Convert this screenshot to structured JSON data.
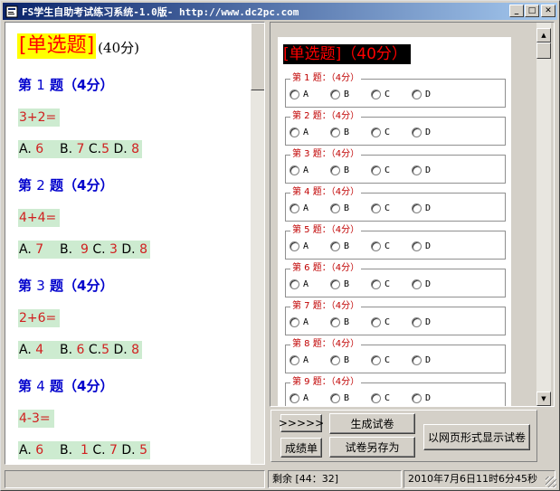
{
  "window": {
    "title": "FS学生自助考试练习系统-1.0版- http://www.dc2pc.com",
    "minimize": "_",
    "maximize": "□",
    "close": "✕"
  },
  "left": {
    "header_bracket": "[单选题]",
    "header_points": "(40分)",
    "questions": [
      {
        "title_a": "第",
        "num": "1",
        "title_b": "题（4分）",
        "expr": "3+2=",
        "opts": {
          "a_lab": "A.",
          "a_val": "6",
          "b_lab": "B.",
          "b_val": "7",
          "c_lab": "C.",
          "c_val": "5",
          "d_lab": "D.",
          "d_val": "8"
        }
      },
      {
        "title_a": "第",
        "num": "2",
        "title_b": "题（4分）",
        "expr": "4+4=",
        "opts": {
          "a_lab": "A.",
          "a_val": "7",
          "b_lab": "B.",
          "b_val": "9",
          "c_lab": "C.",
          "c_val": "3",
          "d_lab": "D.",
          "d_val": "8"
        }
      },
      {
        "title_a": "第",
        "num": "3",
        "title_b": "题（4分）",
        "expr": "2+6=",
        "opts": {
          "a_lab": "A.",
          "a_val": "4",
          "b_lab": "B.",
          "b_val": "6",
          "c_lab": "C.",
          "c_val": "5",
          "d_lab": "D.",
          "d_val": "8"
        }
      },
      {
        "title_a": "第",
        "num": "4",
        "title_b": "题（4分）",
        "expr": "4-3=",
        "opts": {
          "a_lab": "A.",
          "a_val": "6",
          "b_lab": "B.",
          "b_val": "1",
          "c_lab": "C.",
          "c_val": "7",
          "d_lab": "D.",
          "d_val": "5"
        }
      }
    ]
  },
  "right": {
    "header": "[单选题]（40分）",
    "questions": [
      {
        "title": "第 1 题：（4分）"
      },
      {
        "title": "第 2 题：（4分）"
      },
      {
        "title": "第 3 题：（4分）"
      },
      {
        "title": "第 4 题：（4分）"
      },
      {
        "title": "第 5 题：（4分）"
      },
      {
        "title": "第 6 题：（4分）"
      },
      {
        "title": "第 7 题：（4分）"
      },
      {
        "title": "第 8 题：（4分）"
      },
      {
        "title": "第 9 题：（4分）"
      }
    ],
    "option_labels": [
      "A",
      "B",
      "C",
      "D"
    ]
  },
  "buttons": {
    "next": ">>>>>",
    "generate": "生成试卷",
    "web_view": "以网页形式显示试卷",
    "score": "成绩单",
    "save_as": "试卷另存为"
  },
  "status": {
    "remaining": "剩余 [44：32]",
    "datetime": "2010年7月6日11时6分45秒"
  }
}
